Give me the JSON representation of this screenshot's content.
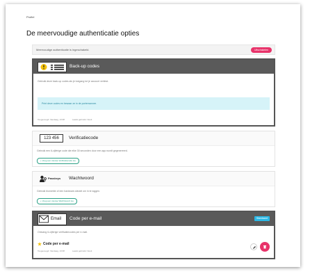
{
  "breadcrumb": "Profiel",
  "page_title": "De meervoudige authenticatie opties",
  "status": {
    "text": "Meervoudige authenticatie is ingeschakeld.",
    "button": "Uitschakelen"
  },
  "backup": {
    "title": "Back-up codes",
    "description": "Gebruik deze back-up codes als je toegang tot je account verliest.",
    "info_text": "Print deze codes en bewaar ze in de portemonnee.",
    "created": "Toegevoegd: Vandaag, 13:08",
    "last_used": "Laatst gebruikt: Nooit"
  },
  "verification": {
    "code_icon": "123 456",
    "title": "Verificatiecode",
    "description": "Gebruik een 6-cijferige code die elke 30 seconden door een app wordt gegenereerd.",
    "add_label": "+ Voeg een nieuwe Verificatiecode toe"
  },
  "password": {
    "icon_label": "Passkeys",
    "title": "Wachtwoord",
    "description": "Gebruik biometrie of een hardware-sleutel om in te loggen.",
    "add_label": "+ Voeg een nieuwe Wachtwoord toe"
  },
  "email": {
    "icon_label": "Email",
    "title": "Code per e-mail",
    "badge": "Standaard",
    "description": "Ontvang 6-cijferige verificatiecodes per e-mail.",
    "item_title": "Code per e-mail",
    "created": "Toegevoegd: Vandaag, 13:08",
    "last_used": "Laatst gebruikt: Nooit"
  },
  "colors": {
    "accent_pink": "#e8336a",
    "accent_teal": "#29a085",
    "info_bg": "#d6f3f8",
    "badge_blue": "#2bb8e6",
    "header_dark": "#5a5a5a"
  }
}
